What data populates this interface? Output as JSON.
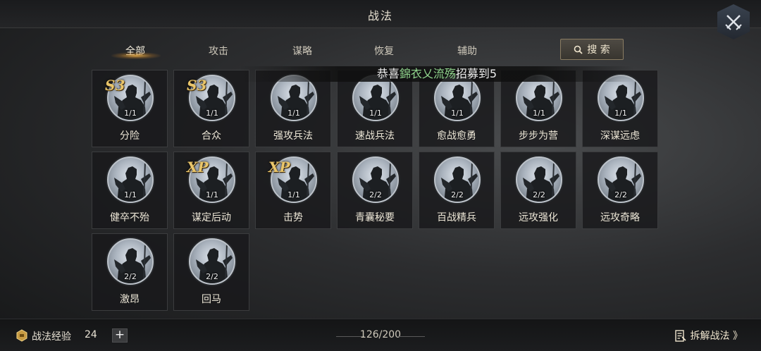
{
  "header": {
    "title": "战法"
  },
  "tabs": [
    {
      "label": "全部",
      "active": true
    },
    {
      "label": "攻击",
      "active": false
    },
    {
      "label": "谋略",
      "active": false
    },
    {
      "label": "恢复",
      "active": false
    },
    {
      "label": "辅助",
      "active": false
    }
  ],
  "search": {
    "label": "搜 索",
    "icon": "search-icon"
  },
  "notice": {
    "prefix": "恭喜",
    "name": "錦衣乂流殇",
    "suffix": "招募到5",
    "name_color": "#8fd38c"
  },
  "tactics": [
    {
      "name": "分险",
      "count": "1/1",
      "badge": "S3"
    },
    {
      "name": "合众",
      "count": "1/1",
      "badge": "S3"
    },
    {
      "name": "强攻兵法",
      "count": "1/1",
      "badge": ""
    },
    {
      "name": "速战兵法",
      "count": "1/1",
      "badge": ""
    },
    {
      "name": "愈战愈勇",
      "count": "1/1",
      "badge": ""
    },
    {
      "name": "步步为营",
      "count": "1/1",
      "badge": ""
    },
    {
      "name": "深谋远虑",
      "count": "1/1",
      "badge": ""
    },
    {
      "name": "健卒不殆",
      "count": "1/1",
      "badge": ""
    },
    {
      "name": "谋定后动",
      "count": "1/1",
      "badge": "XP"
    },
    {
      "name": "击势",
      "count": "1/1",
      "badge": "XP"
    },
    {
      "name": "青囊秘要",
      "count": "2/2",
      "badge": ""
    },
    {
      "name": "百战精兵",
      "count": "2/2",
      "badge": ""
    },
    {
      "name": "远攻强化",
      "count": "2/2",
      "badge": ""
    },
    {
      "name": "远攻奇略",
      "count": "2/2",
      "badge": ""
    },
    {
      "name": "激昂",
      "count": "2/2",
      "badge": ""
    },
    {
      "name": "回马",
      "count": "2/2",
      "badge": ""
    }
  ],
  "footer": {
    "exp_label": "战法经验",
    "exp_value": "24",
    "plus_label": "+",
    "capacity": "126/200",
    "dismantle_label": "拆解战法 》"
  },
  "colors": {
    "accent_gold": "#e9c56a",
    "background": "#2c2d2f"
  }
}
